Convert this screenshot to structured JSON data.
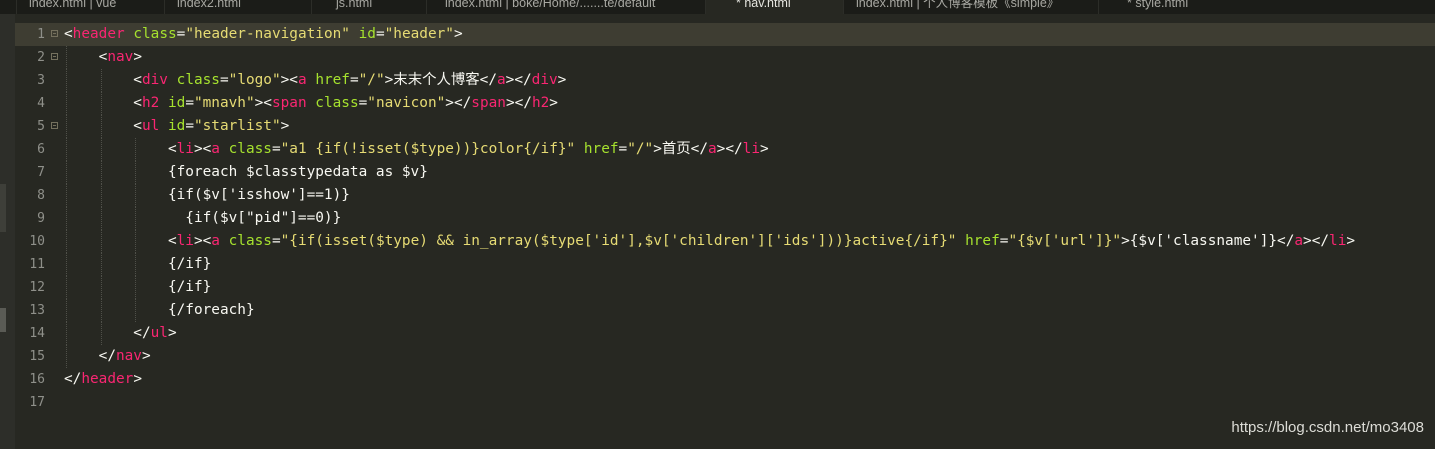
{
  "tabs": [
    {
      "label": "index.html | vue",
      "active": false
    },
    {
      "label": "index2.html",
      "active": false
    },
    {
      "label": "js.html",
      "active": false
    },
    {
      "label": "index.html | boke/Home/.......te/default",
      "active": false
    },
    {
      "label": "* nav.html",
      "active": true
    },
    {
      "label": "index.html | 个人博客模板《simple》",
      "active": false
    },
    {
      "label": "* style.html",
      "active": false
    }
  ],
  "lines": [
    {
      "n": "1",
      "fold": true,
      "current": true,
      "tokens": [
        [
          "pl",
          "<"
        ],
        [
          "tg",
          "header"
        ],
        [
          "pl",
          " "
        ],
        [
          "at",
          "class"
        ],
        [
          "pl",
          "="
        ],
        [
          "st",
          "\"header-navigation\""
        ],
        [
          "pl",
          " "
        ],
        [
          "at",
          "id"
        ],
        [
          "pl",
          "="
        ],
        [
          "st",
          "\"header\""
        ],
        [
          "pl",
          ">"
        ]
      ]
    },
    {
      "n": "2",
      "fold": true,
      "current": false,
      "tokens": [
        [
          "pl",
          "    <"
        ],
        [
          "tg",
          "nav"
        ],
        [
          "pl",
          ">"
        ]
      ]
    },
    {
      "n": "3",
      "fold": false,
      "current": false,
      "tokens": [
        [
          "pl",
          "        <"
        ],
        [
          "tg",
          "div"
        ],
        [
          "pl",
          " "
        ],
        [
          "at",
          "class"
        ],
        [
          "pl",
          "="
        ],
        [
          "st",
          "\"logo\""
        ],
        [
          "pl",
          "><"
        ],
        [
          "tg",
          "a"
        ],
        [
          "pl",
          " "
        ],
        [
          "at",
          "href"
        ],
        [
          "pl",
          "="
        ],
        [
          "st",
          "\"/\""
        ],
        [
          "pl",
          ">末末个人博客</"
        ],
        [
          "tg",
          "a"
        ],
        [
          "pl",
          "></"
        ],
        [
          "tg",
          "div"
        ],
        [
          "pl",
          ">"
        ]
      ]
    },
    {
      "n": "4",
      "fold": false,
      "current": false,
      "tokens": [
        [
          "pl",
          "        <"
        ],
        [
          "tg",
          "h2"
        ],
        [
          "pl",
          " "
        ],
        [
          "at",
          "id"
        ],
        [
          "pl",
          "="
        ],
        [
          "st",
          "\"mnavh\""
        ],
        [
          "pl",
          "><"
        ],
        [
          "tg",
          "span"
        ],
        [
          "pl",
          " "
        ],
        [
          "at",
          "class"
        ],
        [
          "pl",
          "="
        ],
        [
          "st",
          "\"navicon\""
        ],
        [
          "pl",
          "></"
        ],
        [
          "tg",
          "span"
        ],
        [
          "pl",
          "></"
        ],
        [
          "tg",
          "h2"
        ],
        [
          "pl",
          ">"
        ]
      ]
    },
    {
      "n": "5",
      "fold": true,
      "current": false,
      "tokens": [
        [
          "pl",
          "        <"
        ],
        [
          "tg",
          "ul"
        ],
        [
          "pl",
          " "
        ],
        [
          "at",
          "id"
        ],
        [
          "pl",
          "="
        ],
        [
          "st",
          "\"starlist\""
        ],
        [
          "pl",
          ">"
        ]
      ]
    },
    {
      "n": "6",
      "fold": false,
      "current": false,
      "tokens": [
        [
          "pl",
          "            <"
        ],
        [
          "tg",
          "li"
        ],
        [
          "pl",
          "><"
        ],
        [
          "tg",
          "a"
        ],
        [
          "pl",
          " "
        ],
        [
          "at",
          "class"
        ],
        [
          "pl",
          "="
        ],
        [
          "st",
          "\"a1 {if(!isset($type))}color{/if}\""
        ],
        [
          "pl",
          " "
        ],
        [
          "at",
          "href"
        ],
        [
          "pl",
          "="
        ],
        [
          "st",
          "\"/\""
        ],
        [
          "pl",
          ">首页</"
        ],
        [
          "tg",
          "a"
        ],
        [
          "pl",
          "></"
        ],
        [
          "tg",
          "li"
        ],
        [
          "pl",
          ">"
        ]
      ]
    },
    {
      "n": "7",
      "fold": false,
      "current": false,
      "tokens": [
        [
          "pl",
          "            {foreach $classtypedata as $v}"
        ]
      ]
    },
    {
      "n": "8",
      "fold": false,
      "current": false,
      "tokens": [
        [
          "pl",
          "            {if($v['isshow']==1)}"
        ]
      ]
    },
    {
      "n": "9",
      "fold": false,
      "current": false,
      "tokens": [
        [
          "pl",
          "              {if($v[\"pid\"]==0)}"
        ]
      ]
    },
    {
      "n": "10",
      "fold": false,
      "current": false,
      "tokens": [
        [
          "pl",
          "            <"
        ],
        [
          "tg",
          "li"
        ],
        [
          "pl",
          "><"
        ],
        [
          "tg",
          "a"
        ],
        [
          "pl",
          " "
        ],
        [
          "at",
          "class"
        ],
        [
          "pl",
          "="
        ],
        [
          "st",
          "\"{if(isset($type) && in_array($type['id'],$v['children']['ids']))}active{/if}\""
        ],
        [
          "pl",
          " "
        ],
        [
          "at",
          "href"
        ],
        [
          "pl",
          "="
        ],
        [
          "st",
          "\"{$v['url']}\""
        ],
        [
          "pl",
          ">{$v['classname']}</"
        ],
        [
          "tg",
          "a"
        ],
        [
          "pl",
          "></"
        ],
        [
          "tg",
          "li"
        ],
        [
          "pl",
          ">"
        ]
      ]
    },
    {
      "n": "11",
      "fold": false,
      "current": false,
      "tokens": [
        [
          "pl",
          "            {/if}"
        ]
      ]
    },
    {
      "n": "12",
      "fold": false,
      "current": false,
      "tokens": [
        [
          "pl",
          "            {/if}"
        ]
      ]
    },
    {
      "n": "13",
      "fold": false,
      "current": false,
      "tokens": [
        [
          "pl",
          "            {/foreach}"
        ]
      ]
    },
    {
      "n": "14",
      "fold": false,
      "current": false,
      "tokens": [
        [
          "pl",
          "        </"
        ],
        [
          "tg",
          "ul"
        ],
        [
          "pl",
          ">"
        ]
      ]
    },
    {
      "n": "15",
      "fold": false,
      "current": false,
      "tokens": [
        [
          "pl",
          "    </"
        ],
        [
          "tg",
          "nav"
        ],
        [
          "pl",
          ">"
        ]
      ]
    },
    {
      "n": "16",
      "fold": false,
      "current": false,
      "tokens": [
        [
          "pl",
          "</"
        ],
        [
          "tg",
          "header"
        ],
        [
          "pl",
          ">"
        ]
      ]
    },
    {
      "n": "17",
      "fold": false,
      "current": false,
      "tokens": []
    }
  ],
  "watermark": "https://blog.csdn.net/mo3408",
  "colors": {
    "background": "#272822",
    "tag": "#f92672",
    "attribute": "#a6e22e",
    "string": "#e6db74",
    "text": "#f8f8f2"
  }
}
